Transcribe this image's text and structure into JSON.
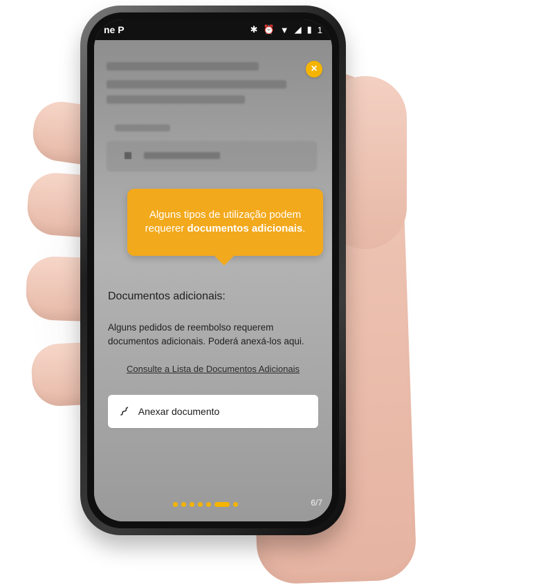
{
  "status_bar": {
    "left": "ne P",
    "right_icons": [
      "bluetooth-icon",
      "alarm-icon",
      "wifi-icon",
      "signal-icon",
      "battery-icon"
    ],
    "time": "1"
  },
  "close_label": "×",
  "tooltip": {
    "line1": "Alguns tipos de utilização podem",
    "line2_prefix": "requerer ",
    "line2_bold": "documentos adicionais",
    "line2_suffix": "."
  },
  "section": {
    "title": "Documentos adicionais:",
    "description": "Alguns pedidos de reembolso requerem documentos adicionais. Poderá anexá-los aqui.",
    "link": "Consulte a Lista de Documentos Adicionais"
  },
  "attach_button": {
    "icon": "paperclip-icon",
    "label": "Anexar documento"
  },
  "pager": {
    "total_dots": 7,
    "active_index": 5,
    "count": "6/7"
  },
  "colors": {
    "accent": "#f5b400",
    "tooltip": "#f3a91c"
  }
}
